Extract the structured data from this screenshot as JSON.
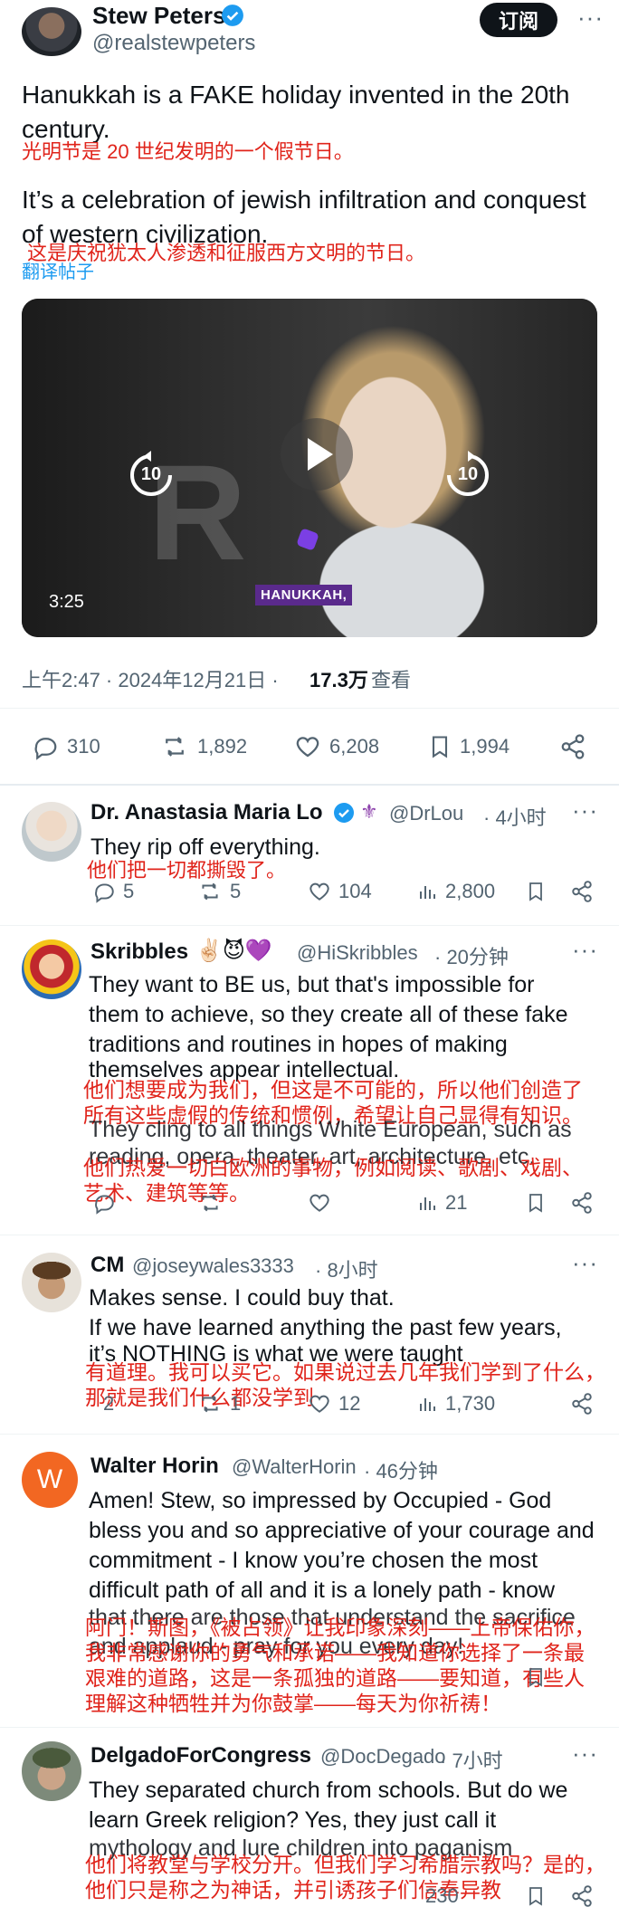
{
  "header": {
    "name": "Stew Peters",
    "handle": "@realstewpeters",
    "subscribe_label": "订阅"
  },
  "post": {
    "text_line1": "Hanukkah is a FAKE holiday invented in the 20th",
    "text_line2": "century.",
    "cn_line1": "光明节是 20 世纪发明的一个假节日。",
    "text_line3": "It’s a celebration of jewish infiltration and conquest",
    "text_line4": "of western civilization.",
    "cn_line2": "这是庆祝犹太人渗透和征服西方文明的节日。",
    "translate_label": "翻译帖子",
    "video": {
      "duration": "3:25",
      "caption": "HANUKKAH,",
      "rewind_label": "10",
      "forward_label": "10"
    },
    "meta": {
      "time": "上午2:47 · 2024年12月21日 ·",
      "views": "17.3万",
      "views_label": "查看"
    },
    "stats": {
      "replies": "310",
      "reposts": "1,892",
      "likes": "6,208",
      "bookmarks": "1,994"
    }
  },
  "replies": [
    {
      "name": "Dr. Anastasia Maria Lo",
      "handle": "@DrLou",
      "time": "· 4小时",
      "lines": [
        "They rip off everything."
      ],
      "cn": [
        "他们把一切都撕毁了。"
      ],
      "replies": "5",
      "reposts": "5",
      "likes": "104",
      "views": "2,800"
    },
    {
      "name": "Skribbles",
      "emojis": "✌🏻😈💜",
      "handle": "@HiSkribbles",
      "time": "· 20分钟",
      "lines": [
        "They want to BE us, but that's impossible for",
        "them to achieve, so they create all of these fake",
        "traditions and routines in hopes of making",
        "themselves appear intellectual.",
        "They cling to all things White European, such as",
        "reading, opera, theater, art, architecture, etc."
      ],
      "cn": [
        "他们想要成为我们，但这是不可能的，所以他们创造了",
        "所有这些虚假的传统和惯例，希望让自己显得有知识。",
        "他们热爱一切白欧洲的事物，例如阅读、歌剧、戏剧、",
        "艺术、建筑等等。"
      ],
      "views": "21"
    },
    {
      "name": "CM",
      "handle": "@joseywales3333",
      "time": "· 8小时",
      "lines": [
        "Makes sense. I could buy that.",
        "If we have learned anything the past few years,",
        "it’s NOTHING is what we were taught"
      ],
      "cn": [
        "有道理。我可以买它。如果说过去几年我们学到了什么，",
        "那就是我们什么都没学到"
      ],
      "replies": "2",
      "reposts": "1",
      "likes": "12",
      "views": "1,730"
    },
    {
      "name": "Walter Horin",
      "avatar_letter": "W",
      "handle": "@WalterHorin",
      "time": "· 46分钟",
      "lines": [
        "Amen! Stew, so impressed by Occupied - God",
        "bless you and so appreciative of your courage and",
        "commitment - I know you’re chosen the most",
        "difficult path of all and it is a lonely path - know",
        "that there are those that understand the sacrifice",
        "and applaud - pray for you every day!"
      ],
      "cn": [
        "阿门！斯图，《被占领》让我印象深刻——上帝保佑你，",
        "我非常感谢你的勇气和承诺——我知道你选择了一条最",
        "艰难的道路，这是一条孤独的道路——要知道，有些人",
        "理解这种牺牲并为你鼓掌——每天为你祈祷！"
      ]
    },
    {
      "name": "DelgadoForCongress",
      "handle": "@DocDegado",
      "time": "· 7小时",
      "lines": [
        "They separated church from schools. But do we",
        "learn Greek religion? Yes, they just call it",
        "mythology and lure children into paganism"
      ],
      "cn": [
        "他们将教堂与学校分开。但我们学习希腊宗教吗？是的，",
        "他们只是称之为神话，并引诱孩子们信奉异教"
      ],
      "views": "230"
    }
  ],
  "colors": {
    "verified": "#1d9bf0",
    "translation": "#e0241b",
    "link": "#1d9bf0",
    "muted": "#536471"
  }
}
